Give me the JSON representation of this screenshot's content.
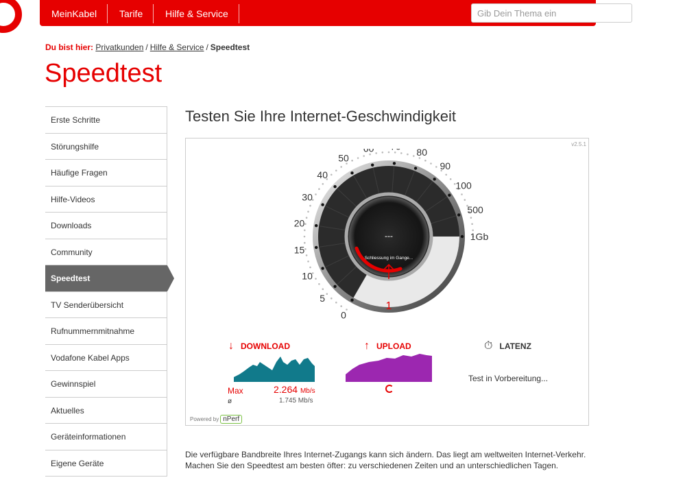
{
  "colors": {
    "brand": "#e60000",
    "dark": "#333333",
    "upload": "#9c27b0",
    "download": "#117a8b"
  },
  "nav": {
    "items": [
      "MeinKabel",
      "Tarife",
      "Hilfe & Service"
    ],
    "search_placeholder": "Gib Dein Thema ein"
  },
  "breadcrumb": {
    "label": "Du bist hier:",
    "links": [
      "Privatkunden",
      "Hilfe & Service"
    ],
    "current": "Speedtest"
  },
  "page_title": "Speedtest",
  "sidebar": {
    "items": [
      "Erste Schritte",
      "Störungshilfe",
      "Häufige Fragen",
      "Hilfe-Videos",
      "Downloads",
      "Community",
      "Speedtest",
      "TV Senderübersicht",
      "Rufnummernmitnahme",
      "Vodafone Kabel Apps",
      "Gewinnspiel",
      "Aktuelles",
      "Geräteinformationen",
      "Eigene Geräte"
    ],
    "active": "Speedtest"
  },
  "section_title": "Testen Sie Ihre Internet-Geschwindigkeit",
  "widget": {
    "version": "v2.5.1",
    "gauge": {
      "scale_labels": [
        "0",
        "5",
        "10",
        "15",
        "20",
        "30",
        "40",
        "50",
        "60",
        "70",
        "80",
        "90",
        "100",
        "500",
        "1Gb"
      ],
      "center_value": "---",
      "status": "Schliessung im Gange...",
      "bottom_value": "1"
    },
    "download": {
      "label": "DOWNLOAD",
      "max_label": "Max",
      "max_value": "2.264",
      "max_unit": "Mb/s",
      "avg_label": "ø",
      "avg_value": "1.745 Mb/s"
    },
    "upload": {
      "label": "UPLOAD"
    },
    "latency": {
      "label": "LATENZ",
      "status": "Test in Vorbereitung..."
    },
    "powered_by": "Powered by",
    "powered_brand": "nPerf"
  },
  "info_lines": [
    "Die verfügbare Bandbreite Ihres Internet-Zugangs kann sich ändern. Das liegt am weltweiten Internet-Verkehr.",
    "Machen Sie den Speedtest am besten öfter: zu verschiedenen Zeiten und an unterschiedlichen Tagen."
  ]
}
